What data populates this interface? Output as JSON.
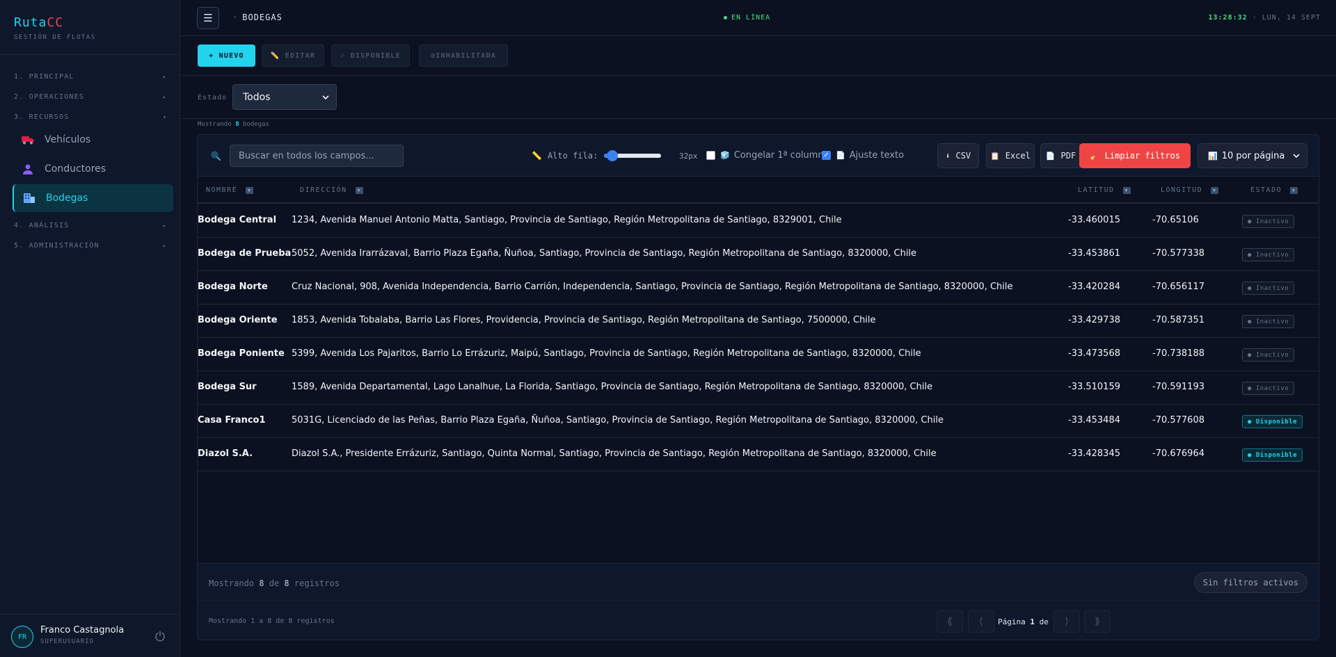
{
  "sidebar": {
    "brand_a": "Ruta",
    "brand_b": "CC",
    "subtitle": "GESTIÓN DE FLOTAS",
    "sections": [
      {
        "label": "1. PRINCIPAL",
        "arrow": "▸"
      },
      {
        "label": "2. OPERACIONES",
        "arrow": "▸"
      },
      {
        "label": "3. RECURSOS",
        "arrow": "▾"
      },
      {
        "label": "4. ANÁLISIS",
        "arrow": "▸"
      },
      {
        "label": "5. ADMINISTRACIÓN",
        "arrow": "▸"
      }
    ],
    "items": [
      {
        "label": "Vehículos",
        "icon": "truck-icon"
      },
      {
        "label": "Conductores",
        "icon": "person-icon"
      },
      {
        "label": "Bodegas",
        "icon": "warehouse-icon"
      }
    ],
    "user": {
      "initials": "FR",
      "name": "Franco Castagnola",
      "role": "SUPERUSUARIO"
    }
  },
  "header": {
    "menu_glyph": "☰",
    "breadcrumb": "BODEGAS",
    "status": "EN LÍNEA",
    "time": "13:28:32",
    "date": "· LUN, 14 SEPT"
  },
  "toolbar": {
    "new": "+ NUEVO",
    "edit": "✏️ EDITAR",
    "available": "✓ DISPONIBLE",
    "disabled": "⊘INHABILITADA"
  },
  "filter": {
    "label": "Estado",
    "value": "Todos",
    "showing_prefix": "Mostrando",
    "showing_count": "8",
    "showing_suffix": "bodegas"
  },
  "controls": {
    "search_placeholder": "Buscar en todos los campos...",
    "row_height_label": "Alto fila:",
    "row_height_value": "32px",
    "row_height_level": 0.15,
    "freeze_label": "Congelar 1ª columna",
    "freeze_checked": false,
    "wrap_label": "Ajuste texto",
    "wrap_checked": true,
    "csv": "CSV",
    "excel": "Excel",
    "pdf": "PDF",
    "clear": "Limpiar filtros",
    "per_page": "10 por página"
  },
  "table": {
    "columns": [
      "NOMBRE",
      "DIRECCIÓN",
      "LATITUD",
      "LONGITUD",
      "ESTADO"
    ],
    "rows": [
      {
        "name": "Bodega Central",
        "address": "1234, Avenida Manuel Antonio Matta, Santiago, Provincia de Santiago, Región Metropolitana de Santiago, 8329001, Chile",
        "lat": "-33.460015",
        "lng": "-70.65106",
        "status": "● Inactivo",
        "active": false
      },
      {
        "name": "Bodega de Prueba",
        "address": "5052, Avenida Irarrázaval, Barrio Plaza Egaña, Ñuñoa, Santiago, Provincia de Santiago, Región Metropolitana de Santiago, 8320000, Chile",
        "lat": "-33.453861",
        "lng": "-70.577338",
        "status": "● Inactivo",
        "active": false
      },
      {
        "name": "Bodega Norte",
        "address": "Cruz Nacional, 908, Avenida Independencia, Barrio Carrión, Independencia, Santiago, Provincia de Santiago, Región Metropolitana de Santiago, 8320000, Chile",
        "lat": "-33.420284",
        "lng": "-70.656117",
        "status": "● Inactivo",
        "active": false
      },
      {
        "name": "Bodega Oriente",
        "address": "1853, Avenida Tobalaba, Barrio Las Flores, Providencia, Provincia de Santiago, Región Metropolitana de Santiago, 7500000, Chile",
        "lat": "-33.429738",
        "lng": "-70.587351",
        "status": "● Inactivo",
        "active": false
      },
      {
        "name": "Bodega Poniente",
        "address": "5399, Avenida Los Pajaritos, Barrio Lo Errázuriz, Maipú, Santiago, Provincia de Santiago, Región Metropolitana de Santiago, 8320000, Chile",
        "lat": "-33.473568",
        "lng": "-70.738188",
        "status": "● Inactivo",
        "active": false
      },
      {
        "name": "Bodega Sur",
        "address": "1589, Avenida Departamental, Lago Lanalhue, La Florida, Santiago, Provincia de Santiago, Región Metropolitana de Santiago, 8320000, Chile",
        "lat": "-33.510159",
        "lng": "-70.591193",
        "status": "● Inactivo",
        "active": false
      },
      {
        "name": "Casa Franco1",
        "address": "5031G, Licenciado de las Peñas, Barrio Plaza Egaña, Ñuñoa, Santiago, Provincia de Santiago, Región Metropolitana de Santiago, 8320000, Chile",
        "lat": "-33.453484",
        "lng": "-70.577608",
        "status": "● Disponible",
        "active": true
      },
      {
        "name": "Diazol S.A.",
        "address": "Diazol S.A., Presidente Errázuriz, Santiago, Quinta Normal, Santiago, Provincia de Santiago, Región Metropolitana de Santiago, 8320000, Chile",
        "lat": "-33.428345",
        "lng": "-70.676964",
        "status": "● Disponible",
        "active": true
      }
    ]
  },
  "footer": {
    "records_prefix": "Mostrando",
    "records_shown": "8",
    "records_mid": "de",
    "records_total": "8",
    "records_suffix": "registros",
    "no_filters": "Sin filtros activos",
    "range_text": "Mostrando 1 a 8 de 8 registros",
    "first": "⟪",
    "prev": "⟨",
    "next": "⟩",
    "last": "⟫",
    "page_prefix": "Página",
    "page_current": "1",
    "page_mid": "de",
    "page_total": "1"
  },
  "colors": {
    "accent": "#22d3ee",
    "danger": "#ef4444",
    "online": "#4ade80",
    "background": "#0b1120"
  }
}
